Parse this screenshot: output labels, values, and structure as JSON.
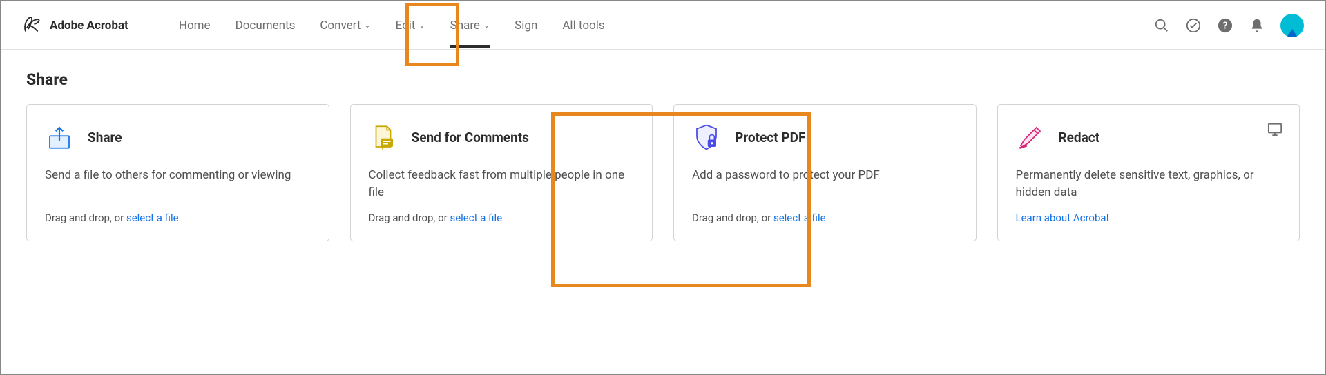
{
  "brand": "Adobe Acrobat",
  "nav": {
    "home": "Home",
    "documents": "Documents",
    "convert": "Convert",
    "edit": "Edit",
    "share": "Share",
    "sign": "Sign",
    "all_tools": "All tools"
  },
  "page": {
    "title": "Share"
  },
  "cards": {
    "share": {
      "title": "Share",
      "desc": "Send a file to others for commenting or viewing",
      "drag_text": "Drag and drop, or ",
      "link": "select a file"
    },
    "send_comments": {
      "title": "Send for Comments",
      "desc": "Collect feedback fast from multiple people in one file",
      "drag_text": "Drag and drop, or ",
      "link": "select a file"
    },
    "protect": {
      "title": "Protect PDF",
      "desc": "Add a password to protect your PDF",
      "drag_text": "Drag and drop, or ",
      "link": "select a file"
    },
    "redact": {
      "title": "Redact",
      "desc": "Permanently delete sensitive text, graphics, or hidden data",
      "link": "Learn about Acrobat"
    }
  }
}
